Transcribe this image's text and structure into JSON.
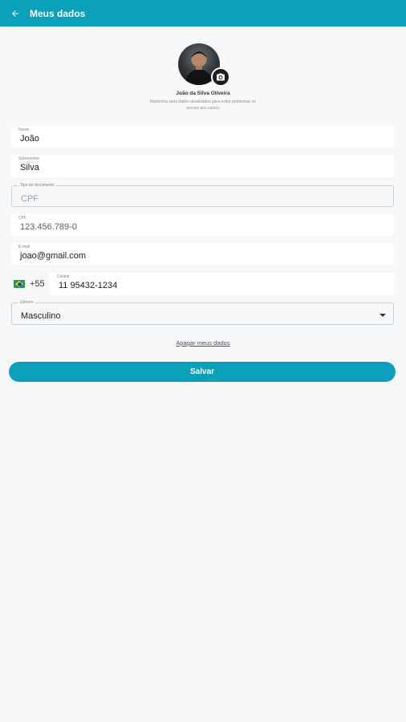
{
  "appbar": {
    "title": "Meus dados",
    "back_icon": "arrow-left-icon"
  },
  "profile": {
    "name": "João da Silva Oliveira",
    "hint": "Mantenha seus dados atualizados para evitar problemas no acesso aos cursos",
    "camera_icon": "camera-icon"
  },
  "form": {
    "first_name": {
      "label": "Nome",
      "value": "João"
    },
    "last_name": {
      "label": "Sobrenome",
      "value": "Silva"
    },
    "document_type": {
      "label": "Tipo de documento",
      "placeholder": "CPF"
    },
    "document_number": {
      "label": "CPF",
      "value": "123.456.789-0"
    },
    "email": {
      "label": "E-mail",
      "value": "joao@gmail.com"
    },
    "phone": {
      "country_code": "+55",
      "label": "Celular",
      "value": "11 95432-1234"
    },
    "gender": {
      "label": "Gênero",
      "value": "Masculino"
    }
  },
  "actions": {
    "delete_label": "Apagar meus dados",
    "save_label": "Salvar"
  },
  "colors": {
    "primary": "#0ba0b9",
    "background": "#f7f8fa"
  }
}
